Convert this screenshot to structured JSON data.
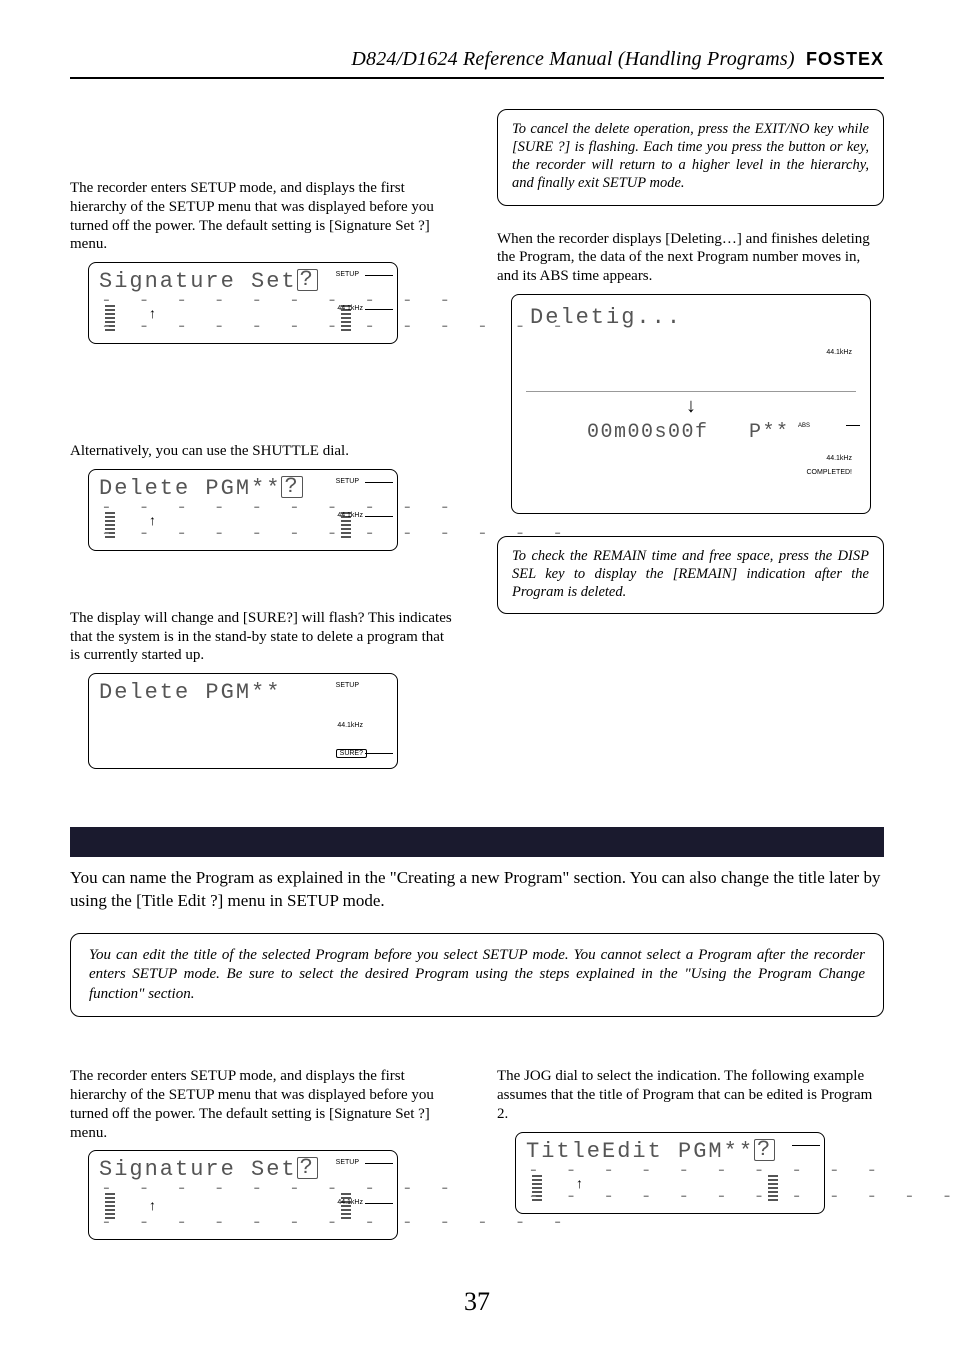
{
  "header": {
    "title": "D824/D1624 Reference Manual (Handling Programs)",
    "brand": "FOSTEX"
  },
  "left": {
    "p1": "The recorder enters SETUP mode, and displays the first hierarchy of the SETUP menu that was displayed before you turned off the power.  The default setting is [Signature Set ?] menu.",
    "lcd1": "Signature Set",
    "p2": "Alternatively, you can use the SHUTTLE dial.",
    "lcd2": "Delete PGM**",
    "p3": "The display will change and [SURE?] will flash? This indicates that the system is in the stand-by state to delete a program that is currently started up.",
    "lcd3": "Delete PGM**"
  },
  "right": {
    "note1": "To cancel the delete operation, press the EXIT/NO key while [SURE ?] is flashing. Each time you press the button or key, the recorder will return to a higher level in the hierarchy, and finally exit SETUP mode.",
    "p1": "When the recorder displays [Deleting…] and finishes deleting the Program, the data of the next Program number moves in, and its ABS time appears.",
    "biglcd_top": "Deletig...",
    "biglcd_bot": "  00m00s00f   P**",
    "note2": "To check the REMAIN time and free space, press the DISP SEL key to display the [REMAIN] indication after the Program is deleted."
  },
  "section": {
    "intro": "You can name the Program as explained in the \"Creating a new Program\" section.  You can also change the title later by using the [Title Edit ?] menu in SETUP mode.",
    "wide_note": "You can edit the title of the selected Program before you select SETUP mode. You cannot select a Program after the recorder enters SETUP mode.  Be sure to select the desired Program using the steps explained in the \"Using the Program Change function\" section."
  },
  "bottom_left": {
    "p1": "The recorder enters SETUP mode, and displays the first hierarchy of the SETUP menu that was displayed before you turned off the power.  The default setting is [Signature Set ?] menu.",
    "lcd": "Signature Set"
  },
  "bottom_right": {
    "p1": "The JOG dial to select the indication.  The following example assumes that the title of Program that can be edited is Program 2.",
    "lcd": "TitleEdit PGM**"
  },
  "labels": {
    "setup": "SETUP",
    "khz": "44.1kHz",
    "sure": "SURE?",
    "abs": "ABS",
    "completed": "COMPLETED!",
    "cursor": "?"
  },
  "page_number": "37"
}
